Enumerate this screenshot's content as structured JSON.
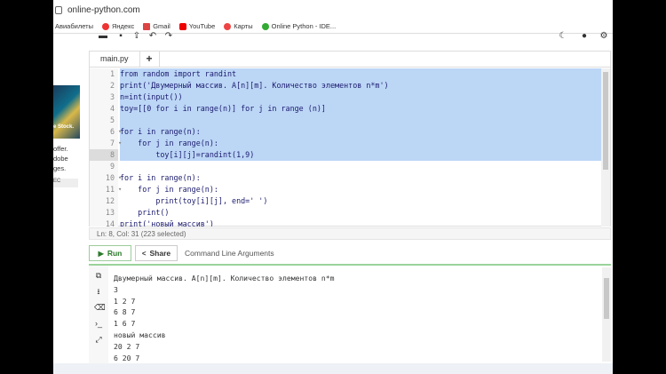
{
  "browser": {
    "url": "online-python.com",
    "bookmarks": [
      {
        "label": "Авиабилеты",
        "icon": "none"
      },
      {
        "label": "Яндекс",
        "icon": "yandex-icon",
        "color": "#e33"
      },
      {
        "label": "Gmail",
        "icon": "gmail-icon",
        "color": "#d44"
      },
      {
        "label": "YouTube",
        "icon": "youtube-icon",
        "color": "#e00"
      },
      {
        "label": "Карты",
        "icon": "maps-icon",
        "color": "#e44"
      },
      {
        "label": "Online Python - IDE...",
        "icon": "python-icon",
        "color": "#3a3"
      }
    ]
  },
  "ad": {
    "image_text": "e Stock.",
    "lines": [
      "offer.",
      "dobe",
      "ges."
    ],
    "button": "ЕС"
  },
  "editor": {
    "tab_label": "main.py",
    "add_tab": "+",
    "lines": [
      {
        "n": "1",
        "text": "from random import randint",
        "fold": "",
        "sel": true
      },
      {
        "n": "2",
        "text": "print('Двумерный массив. A[n][m]. Количество элементов n*m')",
        "fold": "",
        "sel": true
      },
      {
        "n": "3",
        "text": "n=int(input())",
        "fold": "",
        "sel": true
      },
      {
        "n": "4",
        "text": "toy=[[0 for i in range(n)] for j in range (n)]",
        "fold": "",
        "sel": true
      },
      {
        "n": "5",
        "text": "",
        "fold": "",
        "sel": true
      },
      {
        "n": "6",
        "text": "for i in range(n):",
        "fold": "▾",
        "sel": true
      },
      {
        "n": "7",
        "text": "    for j in range(n):",
        "fold": "▾",
        "sel": true
      },
      {
        "n": "8",
        "text": "        toy[i][j]=randint(1,9)",
        "fold": "",
        "sel": true
      },
      {
        "n": "9",
        "text": "",
        "fold": "",
        "sel": false
      },
      {
        "n": "10",
        "text": "for i in range(n):",
        "fold": "▾",
        "sel": false
      },
      {
        "n": "11",
        "text": "    for j in range(n):",
        "fold": "▾",
        "sel": false
      },
      {
        "n": "12",
        "text": "        print(toy[i][j], end=' ')",
        "fold": "",
        "sel": false
      },
      {
        "n": "13",
        "text": "    print()",
        "fold": "",
        "sel": false
      },
      {
        "n": "14",
        "text": "print('новый массив')",
        "fold": "",
        "sel": false
      }
    ],
    "status": "Ln: 8,  Col: 31 (223 selected)"
  },
  "run_bar": {
    "run_label": "Run",
    "share_label": "Share",
    "args_label": "Command Line Arguments"
  },
  "output": {
    "lines": [
      "Двумерный массив. A[n][m]. Количество элементов n*m",
      "3",
      "1 2 7",
      "6 8 7",
      "1 6 7",
      "новый массив",
      "20 2 7",
      "6 20 7"
    ]
  },
  "colors": {
    "selection": "#bcd6f6",
    "run_green": "#2a7a2a",
    "output_border": "#9ad39a"
  }
}
